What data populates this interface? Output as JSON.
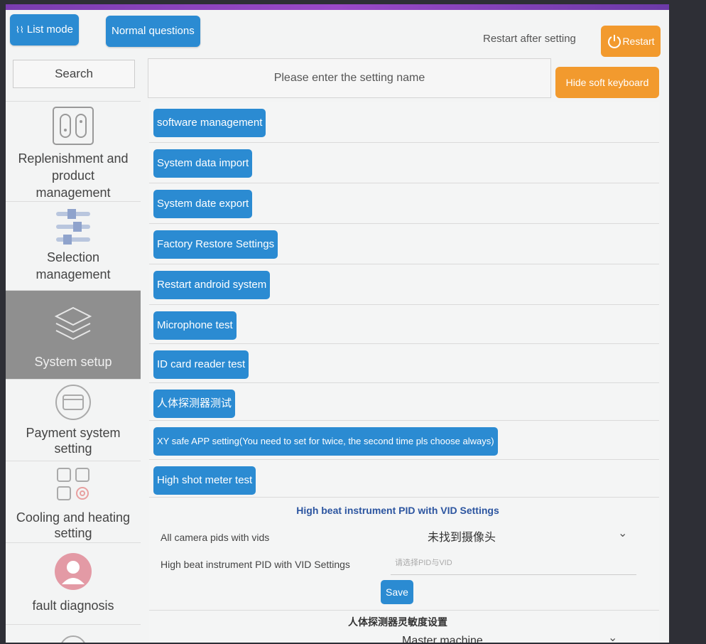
{
  "header": {
    "list_mode_label": "List mode",
    "normal_questions_label": "Normal questions",
    "restart_hint": "Restart after setting",
    "restart_label": "Restart"
  },
  "search": {
    "label": "Search",
    "placeholder": "Please enter the setting name",
    "hide_keyboard_label": "Hide soft keyboard"
  },
  "sidebar": {
    "items": [
      {
        "label": "Replenishment and product management",
        "icon": "vending-machine-icon"
      },
      {
        "label": "Selection management",
        "icon": "sliders-icon"
      },
      {
        "label": "System setup",
        "icon": "layers-icon",
        "active": true
      },
      {
        "label": "Payment system setting",
        "icon": "credit-card-icon"
      },
      {
        "label": "Cooling and heating setting",
        "icon": "grid-gear-icon"
      },
      {
        "label": "fault diagnosis",
        "icon": "technician-icon"
      }
    ]
  },
  "settings": {
    "items": [
      "software management",
      "System data import",
      "System date export",
      "Factory Restore Settings",
      "Restart android system",
      "Microphone test",
      "ID card reader test",
      "人体探测器测试",
      "XY safe APP setting(You need to set for twice, the second time pls choose always)",
      "High shot meter test"
    ],
    "pid_section": {
      "title": "High beat instrument PID with VID Settings",
      "camera_label": "All camera pids with vids",
      "camera_value": "未找到摄像头",
      "pid_label": "High beat instrument PID with VID Settings",
      "pid_placeholder": "请选择PID与VID",
      "save_label": "Save"
    },
    "sensitivity_section": {
      "title": "人体探测器灵敏度设置",
      "value": "Master machine"
    }
  },
  "colors": {
    "button_blue": "#2b8bd2",
    "button_orange": "#f29a2e",
    "sidebar_active": "#8f8f8f"
  }
}
